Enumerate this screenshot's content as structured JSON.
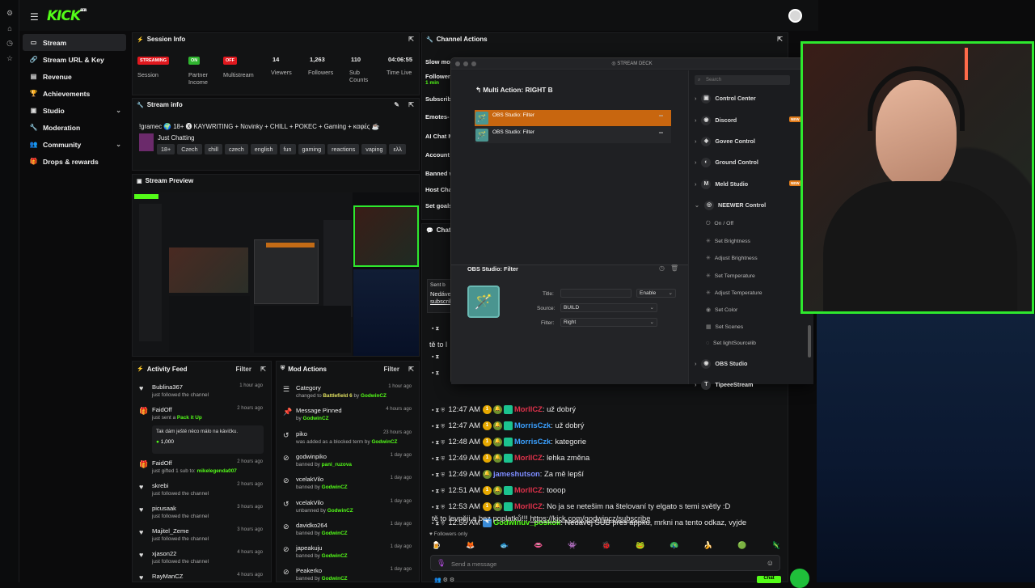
{
  "brand": {
    "logo": "KICK",
    "beta": "BETA",
    "accent": "#53fc18"
  },
  "nav": [
    {
      "label": "Stream",
      "icon": "stream-icon",
      "active": true
    },
    {
      "label": "Stream URL & Key",
      "icon": "key-icon"
    },
    {
      "label": "Revenue",
      "icon": "revenue-icon"
    },
    {
      "label": "Achievements",
      "icon": "trophy-icon"
    },
    {
      "label": "Studio",
      "icon": "studio-icon",
      "chevron": true
    },
    {
      "label": "Moderation",
      "icon": "wrench-icon"
    },
    {
      "label": "Community",
      "icon": "community-icon",
      "chevron": true
    },
    {
      "label": "Drops & rewards",
      "icon": "gift-icon"
    }
  ],
  "session": {
    "title": "Session Info",
    "items": [
      {
        "badge": "STREAMING",
        "badge_color": "#e0181e",
        "label": "Session"
      },
      {
        "badge": "ON",
        "badge_color": "#2fb52f",
        "label": "Partner Income"
      },
      {
        "badge": "OFF",
        "badge_color": "#e0181e",
        "label": "Multistream"
      },
      {
        "value": "14",
        "label": "Viewers"
      },
      {
        "value": "1,263",
        "label": "Followers"
      },
      {
        "value": "110",
        "label": "Sub Counts"
      },
      {
        "value": "04:06:55",
        "label": "Time Live"
      }
    ]
  },
  "streaminfo": {
    "title": "Stream info",
    "stream_title": "!gramec 🌍 18+ 🅧 KAYWRITING + Novinky + CHILL + POKEC + Gaming + καφές ☕",
    "category": "Just Chatting",
    "tags": [
      "18+",
      "Czech",
      "chill",
      "czech",
      "english",
      "fun",
      "gaming",
      "reactions",
      "vaping",
      "ελλ"
    ]
  },
  "preview": {
    "title": "Stream Preview"
  },
  "activity": {
    "title": "Activity Feed",
    "filter": "Filter",
    "items": [
      {
        "name": "Bublina367",
        "sub": "just followed the channel",
        "time": "1 hour ago",
        "icon": "heart-icon"
      },
      {
        "name": "FaidOff",
        "sub": "just sent a",
        "extra": "Pack it Up",
        "time": "2 hours ago",
        "icon": "gift-icon",
        "message": "Tak dám ještě něco málo na kávičku.",
        "amount": "1,000"
      },
      {
        "name": "FaidOff",
        "sub": "just gifted 1 sub to:",
        "extra": "mikelegenda007",
        "time": "2 hours ago",
        "icon": "gift-icon"
      },
      {
        "name": "skrebi",
        "sub": "just followed the channel",
        "time": "2 hours ago",
        "icon": "heart-icon"
      },
      {
        "name": "picusaak",
        "sub": "just followed the channel",
        "time": "3 hours ago",
        "icon": "heart-icon"
      },
      {
        "name": "Majitel_Zeme",
        "sub": "just followed the channel",
        "time": "3 hours ago",
        "icon": "heart-icon"
      },
      {
        "name": "xjason22",
        "sub": "just followed the channel",
        "time": "4 hours ago",
        "icon": "heart-icon"
      },
      {
        "name": "RayManCZ",
        "sub": "",
        "time": "4 hours ago",
        "icon": "heart-icon"
      }
    ]
  },
  "mod": {
    "title": "Mod Actions",
    "filter": "Filter",
    "items": [
      {
        "name": "Category",
        "sub": "changed to",
        "extra": "Battlefield 6",
        "by": "by",
        "who": "GodwinCZ",
        "time": "1 hour ago",
        "icon": "category-icon"
      },
      {
        "name": "Message Pinned",
        "sub": "by",
        "who": "GodwinCZ",
        "time": "4 hours ago",
        "icon": "pin-icon"
      },
      {
        "name": "piko",
        "sub": "was added as a blocked term by",
        "who": "GodwinCZ",
        "time": "23 hours ago",
        "icon": "undo-icon"
      },
      {
        "name": "godwinpiko",
        "sub": "banned by",
        "who": "pani_ruzova",
        "time": "1 day ago",
        "icon": "ban-icon"
      },
      {
        "name": "vcelakVilo",
        "sub": "banned by",
        "who": "GodwinCZ",
        "time": "1 day ago",
        "icon": "ban-icon"
      },
      {
        "name": "vcelakVilo",
        "sub": "unbanned by",
        "who": "GodwinCZ",
        "time": "1 day ago",
        "icon": "undo-icon"
      },
      {
        "name": "davidko264",
        "sub": "banned by",
        "who": "GodwinCZ",
        "time": "1 day ago",
        "icon": "ban-icon"
      },
      {
        "name": "japeakuju",
        "sub": "banned by",
        "who": "GodwinCZ",
        "time": "1 day ago",
        "icon": "ban-icon"
      },
      {
        "name": "Peakerko",
        "sub": "banned by",
        "who": "GodwinCZ",
        "time": "1 day ago",
        "icon": "ban-icon"
      }
    ]
  },
  "channel_actions": {
    "title": "Channel Actions",
    "rows": [
      "Slow mo",
      "Follower",
      "1 min",
      "Subscrib",
      "Emotes-",
      "AI Chat M",
      "Account",
      "Banned w",
      "Host Cha",
      "Set goals"
    ]
  },
  "chat": {
    "title": "Chat",
    "pinned_head": "Sent b",
    "pinned_text": "Nedáve",
    "pinned_link": "subscrib",
    "partial_text": "tě to l",
    "lines": [
      {
        "time": "12:47 AM",
        "user": "MorllCZ",
        "color": "#e0324b",
        "text": ": už dobrý"
      },
      {
        "time": "12:47 AM",
        "user": "MorrisCzk",
        "color": "#3aa0ff",
        "text": ": už dobrý"
      },
      {
        "time": "12:48 AM",
        "user": "MorrisCzk",
        "color": "#3aa0ff",
        "text": ": kategorie"
      },
      {
        "time": "12:49 AM",
        "user": "MorllCZ",
        "color": "#e0324b",
        "text": ": lehka změna"
      },
      {
        "time": "12:49 AM",
        "user": "jameshutson",
        "color": "#7d8cff",
        "text": ": Za mě lepší"
      },
      {
        "time": "12:51 AM",
        "user": "MorllCZ",
        "color": "#e0324b",
        "text": ": tooop"
      },
      {
        "time": "12:53 AM",
        "user": "MorllCZ",
        "color": "#e0324b",
        "text": ": No ja se netešim na štelovaní ty elgato s temi světly :D"
      },
      {
        "time": "12:55 AM",
        "user": "Godwinuv_poskok",
        "color": "#53fc18",
        "text": ": Nedávej SUB přes appku, mrkni na tento odkaz, vyjde"
      }
    ],
    "last_cont": "tě to levněji a bez poplatků!!! ",
    "last_link": "https://kick.com/godwincz/subscribe",
    "followers_only": "Followers only",
    "placeholder": "Send a message",
    "send": "Chat"
  },
  "deck": {
    "window_title": "STREAM DECK",
    "action_title": "Multi Action: RIGHT B",
    "actions": [
      "OBS Studio: Filter",
      "OBS Studio: Filter"
    ],
    "detail_title": "OBS Studio:",
    "detail_sub": "Filter",
    "fields": {
      "title_label": "Title:",
      "title_value": "",
      "enable": "Enable",
      "source_label": "Source:",
      "source_value": "BUILD",
      "filter_label": "Filter:",
      "filter_value": "Right"
    },
    "search": "Search",
    "plugins": [
      {
        "label": "Control Center",
        "icon": "control-center-icon"
      },
      {
        "label": "Discord",
        "icon": "discord-icon",
        "new": true
      },
      {
        "label": "Govee Control",
        "icon": "govee-icon"
      },
      {
        "label": "Ground Control",
        "icon": "ground-control-icon"
      },
      {
        "label": "Meld Studio",
        "icon": "meld-icon",
        "new": true
      },
      {
        "label": "NEEWER Control",
        "icon": "neewer-icon"
      }
    ],
    "subactions": [
      "On / Off",
      "Set Brightness",
      "Adjust Brightness",
      "Set Temperature",
      "Adjust Temperature",
      "Set Color",
      "Set Scenes",
      "Set lightSourcelib"
    ],
    "plugins2": [
      {
        "label": "OBS Studio",
        "icon": "obs-icon"
      },
      {
        "label": "TipeeeStream",
        "icon": "tipeee-icon"
      }
    ],
    "new_badge": "NEW"
  }
}
